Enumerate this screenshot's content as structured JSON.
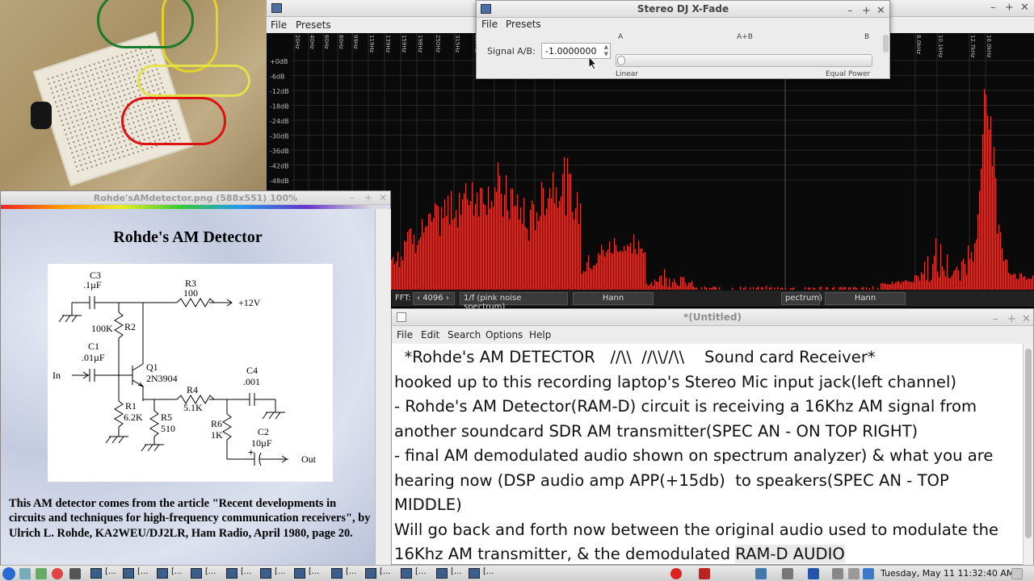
{
  "spectrum": {
    "menu": [
      "File",
      "Presets"
    ],
    "freq_labels": [
      "20Hz",
      "40Hz",
      "60Hz",
      "80Hz",
      "99Hz",
      "119Hz",
      "139Hz",
      "159Hz",
      "198Hz",
      "250Hz",
      "315Hz",
      "397Hz",
      "500Hz",
      "630Hz",
      "794Hz",
      "1.0kHz",
      "8.0kHz",
      "10.1kHz",
      "12.7kHz",
      "16.0kHz"
    ],
    "db_labels": [
      "+0dB",
      "-6dB",
      "-12dB",
      "-18dB",
      "-24dB",
      "-30dB",
      "-36dB",
      "-42dB",
      "-48dB"
    ],
    "fft_label": "FFT:",
    "fft_size": "4096",
    "weighting": "1/f (pink noise spectrum)",
    "window": "Hann",
    "weighting2": "pectrum)",
    "window2": "Hann",
    "bar_color": "#e03a2a"
  },
  "xfade": {
    "title": "Stereo DJ X-Fade",
    "menu": [
      "File",
      "Presets"
    ],
    "signal_label": "Signal A/B:",
    "signal_value": "-1.0000000",
    "scale_a": "A",
    "scale_ab": "A+B",
    "scale_b": "B",
    "left_caption": "Linear",
    "right_caption": "Equal Power"
  },
  "imgviewer": {
    "title": "Rohde'sAMdetector.png (588x551) 100%",
    "heading": "Rohde's AM Detector",
    "caption": "This AM detector comes from the article \"Recent developments in circuits and techniques for high-frequency communication receivers\", by Ulrich L. Rohde, KA2WEU/DJ2LR, Ham Radio, April 1980, page 20.",
    "schematic_labels": {
      "c3": "C3",
      "c3v": ".1µF",
      "r3": "R3",
      "r3v": "100",
      "v12": "+12V",
      "r2v": "100K",
      "r2": "R2",
      "c1": "C1",
      "c1v": ".01µF",
      "in": "In",
      "q1": "Q1",
      "q1v": "2N3904",
      "c4": "C4",
      "c4v": ".001",
      "r4": "R4",
      "r4v": "5.1K",
      "r1": "R1",
      "r1v": "6.2K",
      "r5": "R5",
      "r5v": "510",
      "r6": "R6",
      "r6v": "1K",
      "c2": "C2",
      "c2v": "10µF",
      "out": "Out"
    }
  },
  "editor": {
    "title": "*(Untitled)",
    "menu": [
      "File",
      "Edit",
      "Search",
      "Options",
      "Help"
    ],
    "lines": [
      "  *Rohde's AM DETECTOR   //\\\\  //\\\\//\\\\    Sound card Receiver*",
      "hooked up to this recording laptop's Stereo Mic input jack(left channel)",
      "- Rohde's AM Detector(RAM-D) circuit is receiving a 16Khz AM signal from",
      "another soundcard SDR AM transmitter(SPEC AN - ON TOP RIGHT)",
      "- final AM demodulated audio shown on spectrum analyzer) & what you are",
      "hearing now (DSP audio amp APP(+15db)  to speakers(SPEC AN - TOP",
      "MIDDLE)",
      "Will go back and forth now between the original audio used to modulate the"
    ],
    "last_line_prefix": "16Khz AM transmitter, & the demodulated ",
    "last_line_highlight": "RAM-D AUDIO"
  },
  "taskbar": {
    "clock": "Tuesday, May 11 11:32:40 AM",
    "items": [
      "[...",
      "[...",
      "[...",
      "[...",
      "[...",
      "[...",
      "[...",
      "[...",
      "[...",
      "[...",
      "[...",
      "[..."
    ]
  }
}
